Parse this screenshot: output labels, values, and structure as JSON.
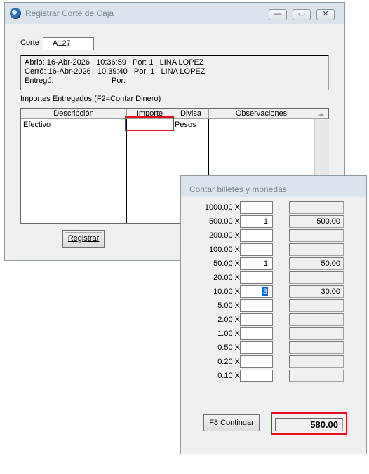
{
  "main_window": {
    "title": "Registrar Corte de Caja",
    "controls": {
      "minimize": "—",
      "maximize": "▭",
      "close": "✕"
    },
    "corte_label": "Corte",
    "corte_value": "A127",
    "info": {
      "abrio": "Abrió: 16-Abr-2026   10:36:59   Por: 1   LINA LOPEZ",
      "cerro": "Cerró: 16-Abr-2026   10:39:40   Por: 1   LINA LOPEZ",
      "entrego_label": "Entregó:",
      "entrego_por": "Por:"
    },
    "importes_label": "Importes Entregados (F2=Contar Dinero)",
    "grid": {
      "columns": [
        "Descripción",
        "Importe",
        "Divisa",
        "Observaciones"
      ],
      "rows": [
        {
          "descripcion": "Efectivo",
          "importe": "",
          "divisa": "Pesos",
          "observaciones": ""
        }
      ]
    },
    "registrar_button": "Registrar"
  },
  "popup": {
    "title": "Contar billetes y monedas",
    "denominations": [
      {
        "label": "1000.00 X",
        "qty": "",
        "amount": ""
      },
      {
        "label": "500.00 X",
        "qty": "1",
        "amount": "500.00"
      },
      {
        "label": "200.00 X",
        "qty": "",
        "amount": ""
      },
      {
        "label": "100.00 X",
        "qty": "",
        "amount": ""
      },
      {
        "label": "50.00 X",
        "qty": "1",
        "amount": "50.00"
      },
      {
        "label": "20.00 X",
        "qty": "",
        "amount": ""
      },
      {
        "label": "10.00 X",
        "qty": "3",
        "amount": "30.00"
      },
      {
        "label": "5.00 X",
        "qty": "",
        "amount": ""
      },
      {
        "label": "2.00 X",
        "qty": "",
        "amount": ""
      },
      {
        "label": "1.00 X",
        "qty": "",
        "amount": ""
      },
      {
        "label": "0.50 X",
        "qty": "",
        "amount": ""
      },
      {
        "label": "0.20 X",
        "qty": "",
        "amount": ""
      },
      {
        "label": "0.10 X",
        "qty": "",
        "amount": ""
      }
    ],
    "selected_row": 6,
    "continue_button": "F8 Continuar",
    "total": "580.00"
  },
  "colors": {
    "highlight_red": "#e01020",
    "selection_blue": "#0a64d6"
  }
}
